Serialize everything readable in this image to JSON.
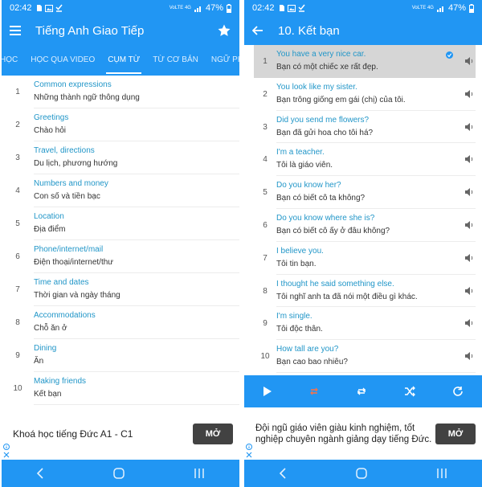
{
  "colors": {
    "primary": "#2196F3",
    "link": "#2196c8",
    "selected_row": "#d6d6d6",
    "ad_button": "#424242",
    "repeat_active": "#ff7043"
  },
  "status": {
    "time": "02:42",
    "battery": "47%",
    "net_label_top": "VoLTE 4G",
    "net_label_bottom": "LTE1 4G"
  },
  "left": {
    "title": "Tiếng Anh Giao Tiếp",
    "tabs": [
      {
        "label": "HỌC"
      },
      {
        "label": "HỌC QUA VIDEO"
      },
      {
        "label": "CỤM TỪ"
      },
      {
        "label": "TỪ CƠ BẢN"
      },
      {
        "label": "NGỮ PHÁ"
      }
    ],
    "items": [
      {
        "num": "1",
        "en": "Common expressions",
        "vi": "Những thành ngữ thông dụng"
      },
      {
        "num": "2",
        "en": "Greetings",
        "vi": "Chào hỏi"
      },
      {
        "num": "3",
        "en": "Travel, directions",
        "vi": "Du lịch, phương hướng"
      },
      {
        "num": "4",
        "en": "Numbers and money",
        "vi": "Con số và tiền bạc"
      },
      {
        "num": "5",
        "en": "Location",
        "vi": "Địa điểm"
      },
      {
        "num": "6",
        "en": "Phone/internet/mail",
        "vi": "Điện thoại/internet/thư"
      },
      {
        "num": "7",
        "en": "Time and dates",
        "vi": "Thời gian và ngày tháng"
      },
      {
        "num": "8",
        "en": "Accommodations",
        "vi": "Chỗ ăn ở"
      },
      {
        "num": "9",
        "en": "Dining",
        "vi": "Ăn"
      },
      {
        "num": "10",
        "en": "Making friends",
        "vi": "Kết bạn"
      }
    ],
    "ad": {
      "text": "Khoá học tiếng Đức A1 - C1",
      "button": "MỞ"
    }
  },
  "right": {
    "title": "10. Kết bạn",
    "items": [
      {
        "num": "1",
        "en": "You have a very nice car.",
        "vi": "Bạn có một chiếc xe rất đẹp."
      },
      {
        "num": "2",
        "en": "You look like my sister.",
        "vi": "Bạn trông giống em gái (chị) của tôi."
      },
      {
        "num": "3",
        "en": "Did you send me flowers?",
        "vi": "Bạn đã gửi hoa cho tôi há?"
      },
      {
        "num": "4",
        "en": "I'm a teacher.",
        "vi": "Tôi là giáo viên."
      },
      {
        "num": "5",
        "en": "Do you know her?",
        "vi": "Bạn có biết cô ta không?"
      },
      {
        "num": "6",
        "en": "Do you know where she is?",
        "vi": "Bạn có biết cô ấy ở đâu không?"
      },
      {
        "num": "7",
        "en": "I believe you.",
        "vi": "Tôi tin bạn."
      },
      {
        "num": "8",
        "en": "I thought he said something else.",
        "vi": "Tôi nghĩ anh ta đã nói một điều gì khác."
      },
      {
        "num": "9",
        "en": "I'm single.",
        "vi": "Tôi độc thân."
      },
      {
        "num": "10",
        "en": "How tall are you?",
        "vi": "Bạn cao bao nhiêu?"
      }
    ],
    "ad": {
      "text": "Đội ngũ giáo viên giàu kinh nghiệm, tốt nghiệp chuyên ngành giảng dạy tiếng Đức.",
      "button": "MỞ"
    }
  }
}
